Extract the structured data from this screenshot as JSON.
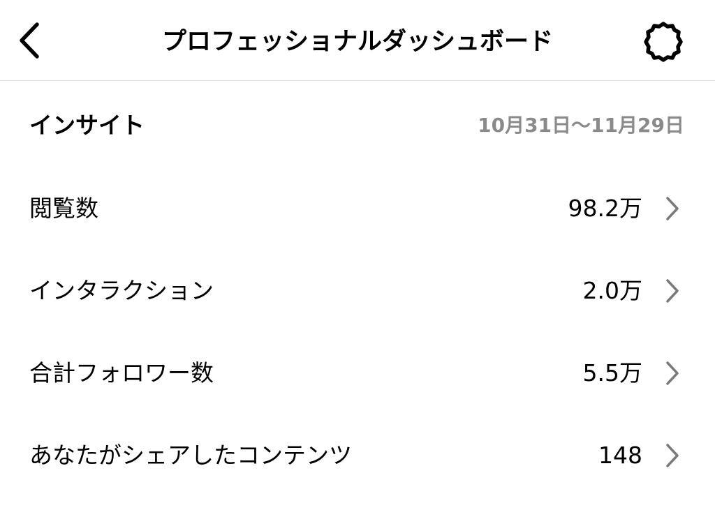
{
  "header": {
    "title": "プロフェッショナルダッシュボード",
    "back_icon": "chevron-left-icon",
    "settings_icon": "gear-icon"
  },
  "insights": {
    "title": "インサイト",
    "date_range": "10月31日〜11月29日",
    "rows": [
      {
        "label": "閲覧数",
        "value": "98.2万"
      },
      {
        "label": "インタラクション",
        "value": "2.0万"
      },
      {
        "label": "合計フォロワー数",
        "value": "5.5万"
      },
      {
        "label": "あなたがシェアしたコンテンツ",
        "value": "148"
      }
    ]
  },
  "colors": {
    "text": "#000000",
    "secondary_text": "#8a8a8a",
    "chevron": "#7a7a7a",
    "divider": "#e0e0e0",
    "background": "#ffffff"
  }
}
